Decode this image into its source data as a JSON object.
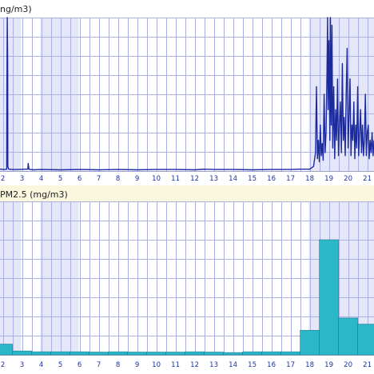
{
  "colors": {
    "band": "#e6e6f9",
    "grid": "#aab0e0",
    "axis_line": "#9aa0c8",
    "tick_label": "#1f2fa0",
    "line_series": "#1b2a9c",
    "bar_fill": "#2cb7c9",
    "bar_stroke": "#1d7f91",
    "title": "#222222",
    "separator": "#fbf7df"
  },
  "panels": {
    "top": {
      "title": "ng/m3)"
    },
    "bottom": {
      "title": "PM2.5 (mg/m3)"
    }
  },
  "chart_data": [
    {
      "type": "line",
      "title": "ng/m3)",
      "xlim": [
        1.85,
        21.35
      ],
      "ylim": [
        0,
        1
      ],
      "x_ticks": [
        "2",
        "3",
        "4",
        "5",
        "6",
        "7",
        "8",
        "9",
        "10",
        "11",
        "12",
        "13",
        "14",
        "15",
        "16",
        "17",
        "18",
        "19",
        "20",
        "21"
      ],
      "grid": true,
      "series": [
        {
          "x": [
            1.85,
            2.1,
            2.2,
            2.21,
            2.23,
            2.25,
            2.26,
            2.3,
            2.5,
            2.8,
            3.2,
            3.3,
            3.32,
            3.36,
            3.4,
            3.6,
            4,
            5,
            6,
            7,
            8,
            9,
            10,
            11,
            12,
            12.5,
            13,
            14,
            15,
            16,
            17,
            17.5,
            18,
            18.2,
            18.3,
            18.35,
            18.4,
            18.45,
            18.5,
            18.55,
            18.6,
            18.65,
            18.7,
            18.75,
            18.8,
            18.85,
            18.9,
            18.93,
            18.96,
            19,
            19.05,
            19.08,
            19.12,
            19.16,
            19.2,
            19.25,
            19.3,
            19.35,
            19.4,
            19.45,
            19.5,
            19.55,
            19.6,
            19.65,
            19.7,
            19.75,
            19.8,
            19.85,
            19.9,
            19.95,
            20,
            20.05,
            20.1,
            20.15,
            20.2,
            20.25,
            20.3,
            20.35,
            20.4,
            20.45,
            20.5,
            20.55,
            20.6,
            20.65,
            20.7,
            20.75,
            20.8,
            20.85,
            20.9,
            20.95,
            21,
            21.05,
            21.1,
            21.15,
            21.2,
            21.25,
            21.3,
            21.35
          ],
          "y": [
            0.012,
            0.01,
            0.012,
            0.5,
            1.0,
            0.7,
            0.03,
            0.012,
            0.01,
            0.01,
            0.012,
            0.012,
            0.05,
            0.012,
            0.01,
            0.008,
            0.01,
            0.008,
            0.01,
            0.008,
            0.01,
            0.008,
            0.01,
            0.01,
            0.008,
            0.012,
            0.01,
            0.01,
            0.008,
            0.01,
            0.01,
            0.012,
            0.012,
            0.03,
            0.12,
            0.55,
            0.08,
            0.2,
            0.06,
            0.3,
            0.1,
            0.18,
            0.07,
            0.5,
            0.12,
            0.25,
            0.65,
            1.0,
            0.4,
            0.85,
            0.2,
            1.0,
            0.3,
            0.95,
            0.15,
            0.55,
            0.08,
            0.4,
            0.2,
            0.6,
            0.1,
            0.3,
            0.45,
            0.12,
            0.7,
            0.2,
            0.35,
            0.1,
            0.5,
            0.8,
            0.15,
            0.35,
            0.6,
            0.1,
            0.3,
            0.2,
            0.45,
            0.08,
            0.3,
            0.15,
            0.55,
            0.1,
            0.25,
            0.4,
            0.12,
            0.3,
            0.1,
            0.2,
            0.5,
            0.1,
            0.25,
            0.3,
            0.08,
            0.2,
            0.12,
            0.25,
            0.1,
            0.2
          ]
        }
      ]
    },
    {
      "type": "bar",
      "title": "PM2.5 (mg/m3)",
      "xlim": [
        1.85,
        21.35
      ],
      "ylim": [
        0,
        1
      ],
      "x_ticks": [
        "2",
        "3",
        "4",
        "5",
        "6",
        "7",
        "8",
        "9",
        "10",
        "11",
        "12",
        "13",
        "14",
        "15",
        "16",
        "17",
        "18",
        "19",
        "20",
        "21"
      ],
      "grid": true,
      "series": [
        {
          "x": [
            2,
            3,
            4,
            5,
            6,
            7,
            8,
            9,
            10,
            11,
            12,
            13,
            14,
            15,
            16,
            17,
            18,
            19,
            20,
            21
          ],
          "values": [
            0.07,
            0.025,
            0.02,
            0.02,
            0.02,
            0.018,
            0.02,
            0.018,
            0.018,
            0.018,
            0.02,
            0.018,
            0.015,
            0.02,
            0.02,
            0.02,
            0.16,
            0.75,
            0.24,
            0.2
          ]
        }
      ]
    }
  ]
}
